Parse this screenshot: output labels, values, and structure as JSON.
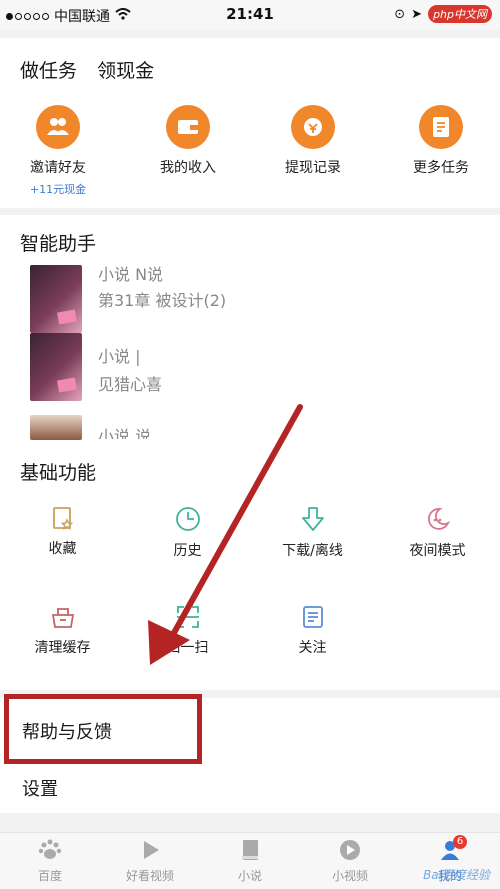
{
  "status_bar": {
    "carrier": "中国联通",
    "time": "21:41",
    "watermark": "php中文网"
  },
  "tasks": {
    "title_tasks": "做任务",
    "title_cash": "领现金",
    "items": [
      {
        "label": "邀请好友",
        "sub": "+11元现金",
        "icon": "invite-icon"
      },
      {
        "label": "我的收入",
        "icon": "wallet-icon"
      },
      {
        "label": "提现记录",
        "icon": "withdraw-record-icon"
      },
      {
        "label": "更多任务",
        "icon": "more-tasks-icon"
      }
    ]
  },
  "assistant": {
    "title": "智能助手",
    "items": [
      {
        "line1": "小说 N说",
        "line2": "第31章 被设计(2)"
      },
      {
        "line1": "小说 |",
        "line2": "见猎心喜"
      },
      {
        "line1": "小说 说"
      }
    ]
  },
  "basic": {
    "title": "基础功能",
    "items": [
      {
        "label": "收藏",
        "icon": "favorite-icon",
        "color": "#c9a15a"
      },
      {
        "label": "历史",
        "icon": "history-icon",
        "color": "#3fb39a"
      },
      {
        "label": "下载/离线",
        "icon": "download-icon",
        "color": "#3fb39a"
      },
      {
        "label": "夜间模式",
        "icon": "night-mode-icon",
        "color": "#d6768a"
      },
      {
        "label": "清理缓存",
        "icon": "clear-cache-icon",
        "color": "#c0646a"
      },
      {
        "label": "扫一扫",
        "icon": "scan-icon",
        "color": "#3fb39a"
      },
      {
        "label": "关注",
        "icon": "follow-icon",
        "color": "#5a8fd6"
      }
    ]
  },
  "help_label": "帮助与反馈",
  "settings_label": "设置",
  "tabbar": {
    "items": [
      {
        "label": "百度",
        "icon": "baidu-paw-icon"
      },
      {
        "label": "好看视频",
        "icon": "play-icon"
      },
      {
        "label": "小说",
        "icon": "book-icon"
      },
      {
        "label": "小视频",
        "icon": "small-video-icon"
      },
      {
        "label": "我的",
        "icon": "profile-icon",
        "badge": "6"
      }
    ],
    "watermark": "Bai百度经验"
  },
  "colors": {
    "accent_orange": "#f0872a",
    "highlight_red": "#b52424"
  }
}
